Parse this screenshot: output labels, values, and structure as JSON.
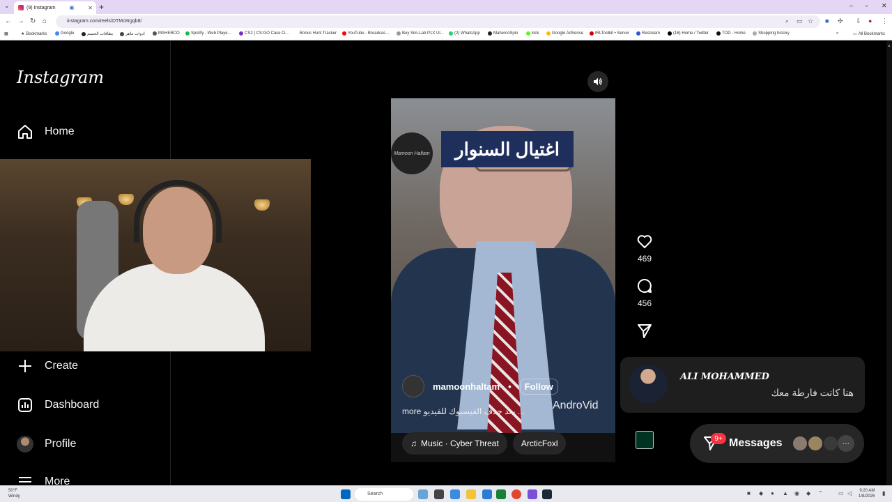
{
  "browser": {
    "tab_title": "(9) Instagram",
    "url": "instagram.com/reels/DTMc8rgqb8/",
    "bookmarks": [
      "Bookmarks",
      "Google",
      "بطاقات الحسم",
      "ادوات ماهر",
      "MAHERCO",
      "Spotify - Web Playe...",
      "CS2 | CS:GO Case O...",
      "Bonus Hunt Tracker",
      "YouTube - Broadcas...",
      "Buy Sim-Lab P1X Ul...",
      "(2) WhatsApp",
      "MahercoSpin",
      "kick",
      "Google AdSense",
      "IRLToolkit • Server",
      "Restream",
      "(16) Home / Twitter",
      "TOD - Home",
      "Shopping history"
    ],
    "all_bookmarks": "All Bookmarks"
  },
  "sidebar": {
    "logo": "Instagram",
    "items": [
      {
        "label": "Home",
        "icon": "home-icon"
      },
      {
        "label": "Create",
        "icon": "plus-icon"
      },
      {
        "label": "Dashboard",
        "icon": "dashboard-icon"
      },
      {
        "label": "Profile",
        "icon": "avatar"
      },
      {
        "label": "More",
        "icon": "menu-icon"
      }
    ]
  },
  "reel": {
    "title_overlay": "اغتيال السنوار",
    "channel_logo_text": "Mamoon Haltam",
    "username": "mamoonhaltam",
    "separator": "•",
    "follow_label": "Follow",
    "caption": "بعد حذف الفيسبوك للفيديو ...",
    "more_label": "more",
    "watermark": "AndroVid",
    "music": "Music · Cyber Threat",
    "audio_user": "ArcticFoxl"
  },
  "actions": {
    "likes": "469",
    "comments": "456"
  },
  "notification": {
    "name": "ALI MOHAMMED",
    "message": "هنا كانت فارطة معك"
  },
  "messages": {
    "label": "Messages",
    "badge": "9+"
  },
  "taskbar": {
    "temp": "50°F",
    "condition": "Windy",
    "search_placeholder": "Search",
    "time": "9:20 AM",
    "date": "1/8/2026"
  },
  "colors": {
    "tabbar": "#e4d6f5",
    "instagram_bg": "#000000",
    "badge_red": "#ff3040",
    "banner_blue": "#1f2f5c"
  }
}
